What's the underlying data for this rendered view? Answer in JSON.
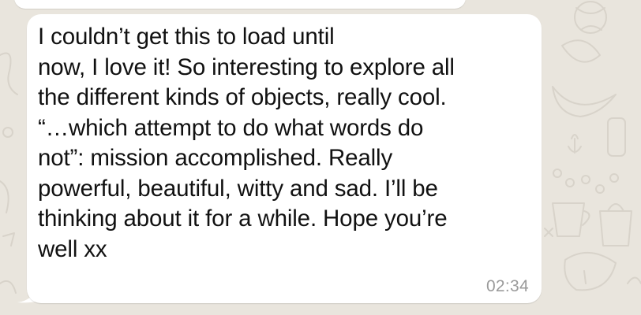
{
  "colors": {
    "wallpaper": "#e9e5dd",
    "wallpaper_doodles": "#d9d4cb",
    "bubble": "#ffffff",
    "text": "#111111",
    "timestamp": "#9a9a9a"
  },
  "chat": {
    "message": {
      "text": "I couldn’t get this to load until\nnow, I love it! So interesting to explore all\nthe different kinds of objects, really cool.\n“…which attempt to do what words do\nnot”: mission accomplished. Really\npowerful, beautiful, witty and sad. I’ll be\nthinking about it for a while. Hope you’re\nwell xx",
      "time": "02:34"
    }
  }
}
